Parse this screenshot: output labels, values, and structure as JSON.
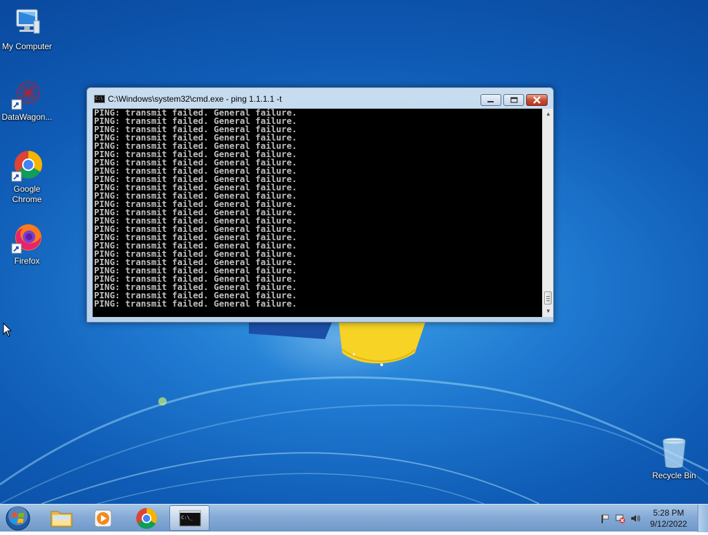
{
  "desktop": {
    "icons": [
      {
        "id": "my-computer",
        "label": "My Computer"
      },
      {
        "id": "datawagon",
        "label": "DataWagon..."
      },
      {
        "id": "google-chrome",
        "label": "Google Chrome"
      },
      {
        "id": "firefox",
        "label": "Firefox"
      },
      {
        "id": "recycle-bin",
        "label": "Recycle Bin"
      }
    ]
  },
  "cmd_window": {
    "title": "C:\\Windows\\system32\\cmd.exe - ping  1.1.1.1 -t",
    "icon": "cmd-icon",
    "controls": {
      "minimize": "minimize-icon",
      "maximize": "maximize-icon",
      "close": "close-icon"
    },
    "output_lines": [
      "PING: transmit failed. General failure.",
      "PING: transmit failed. General failure.",
      "PING: transmit failed. General failure.",
      "PING: transmit failed. General failure.",
      "PING: transmit failed. General failure.",
      "PING: transmit failed. General failure.",
      "PING: transmit failed. General failure.",
      "PING: transmit failed. General failure.",
      "PING: transmit failed. General failure.",
      "PING: transmit failed. General failure.",
      "PING: transmit failed. General failure.",
      "PING: transmit failed. General failure.",
      "PING: transmit failed. General failure.",
      "PING: transmit failed. General failure.",
      "PING: transmit failed. General failure.",
      "PING: transmit failed. General failure.",
      "PING: transmit failed. General failure.",
      "PING: transmit failed. General failure.",
      "PING: transmit failed. General failure.",
      "PING: transmit failed. General failure.",
      "PING: transmit failed. General failure.",
      "PING: transmit failed. General failure.",
      "PING: transmit failed. General failure.",
      "PING: transmit failed. General failure."
    ],
    "console_colors": {
      "background": "#000000",
      "text": "#c0c0c0"
    }
  },
  "taskbar": {
    "start_icon": "windows-logo-icon",
    "pinned": [
      {
        "id": "explorer",
        "icon": "folder-icon"
      },
      {
        "id": "media-player",
        "icon": "media-player-icon"
      },
      {
        "id": "chrome",
        "icon": "chrome-icon"
      },
      {
        "id": "cmd",
        "icon": "cmd-icon",
        "active": true
      }
    ],
    "tray_icons": [
      "action-center-flag-icon",
      "network-error-icon",
      "volume-icon"
    ],
    "clock": {
      "time": "5:28 PM",
      "date": "9/12/2022"
    }
  }
}
